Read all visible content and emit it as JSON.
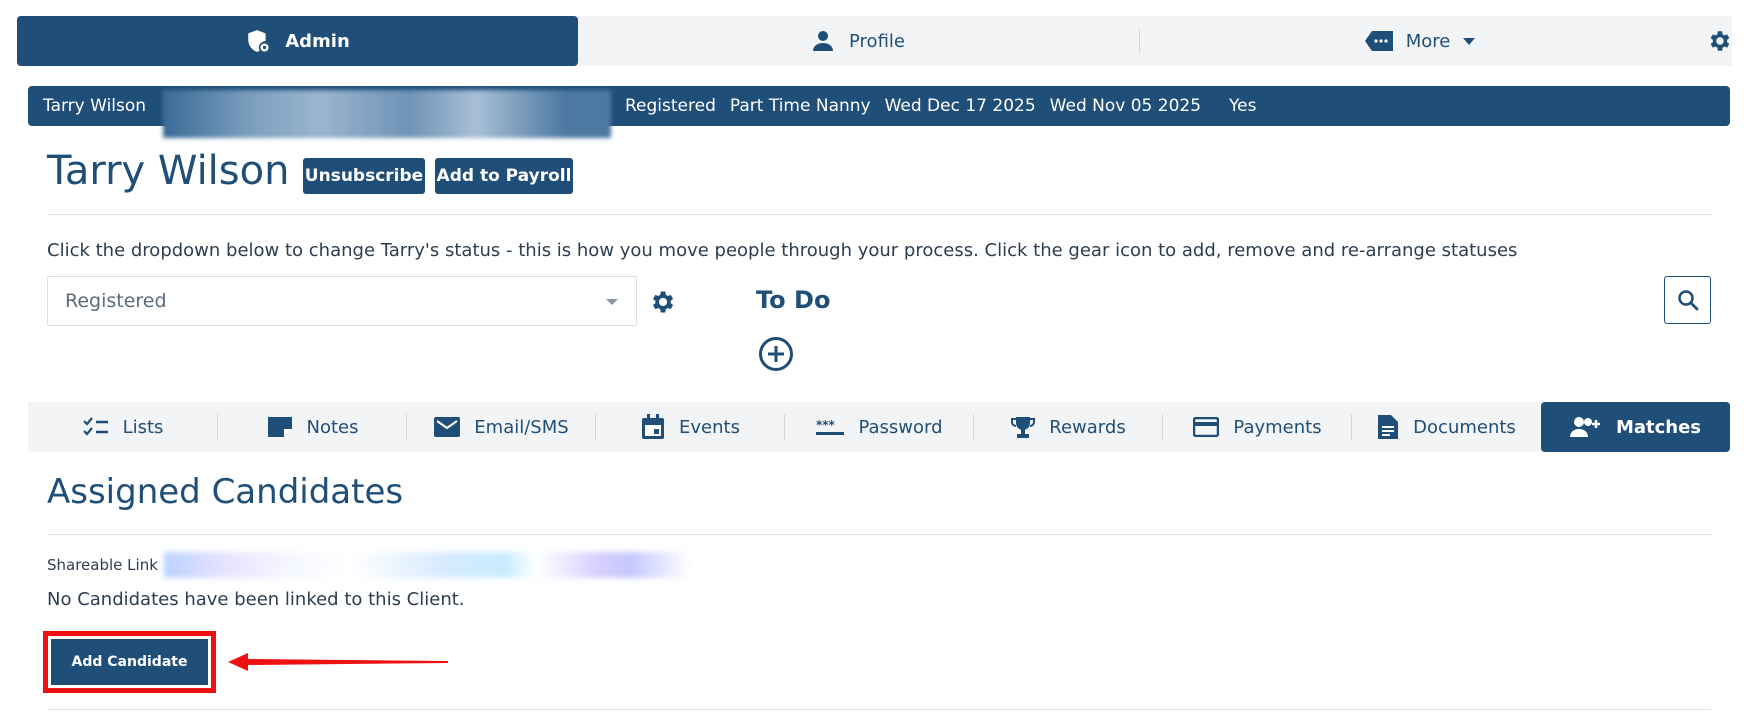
{
  "nav": {
    "admin": "Admin",
    "profile": "Profile",
    "more": "More",
    "settings_icon": "gear-icon"
  },
  "infobar": {
    "name": "Tarry Wilson",
    "status": "Registered",
    "role": "Part Time Nanny",
    "date1": "Wed Dec 17 2025",
    "date2": "Wed Nov 05 2025",
    "flag": "Yes"
  },
  "header": {
    "title": "Tarry Wilson",
    "unsubscribe": "Unsubscribe",
    "add_to_payroll": "Add to Payroll"
  },
  "status": {
    "instruction": "Click the dropdown below to change Tarry's status - this is how you move people through your process. Click the gear icon to add, remove and re-arrange statuses",
    "selected": "Registered"
  },
  "todo": {
    "label": "To Do"
  },
  "tabs": [
    {
      "label": "Lists",
      "icon": "checklist-icon"
    },
    {
      "label": "Notes",
      "icon": "note-icon"
    },
    {
      "label": "Email/SMS",
      "icon": "mail-icon"
    },
    {
      "label": "Events",
      "icon": "calendar-icon"
    },
    {
      "label": "Password",
      "icon": "password-icon"
    },
    {
      "label": "Rewards",
      "icon": "trophy-icon"
    },
    {
      "label": "Payments",
      "icon": "credit-card-icon"
    },
    {
      "label": "Documents",
      "icon": "document-icon"
    },
    {
      "label": "Matches",
      "icon": "user-plus-icon"
    }
  ],
  "section": {
    "title": "Assigned Candidates",
    "shareable_link_label": "Shareable Link",
    "empty_message": "No Candidates have been linked to this Client.",
    "add_candidate": "Add Candidate"
  },
  "colors": {
    "primary": "#1f4e79",
    "highlight": "#ee1111"
  }
}
